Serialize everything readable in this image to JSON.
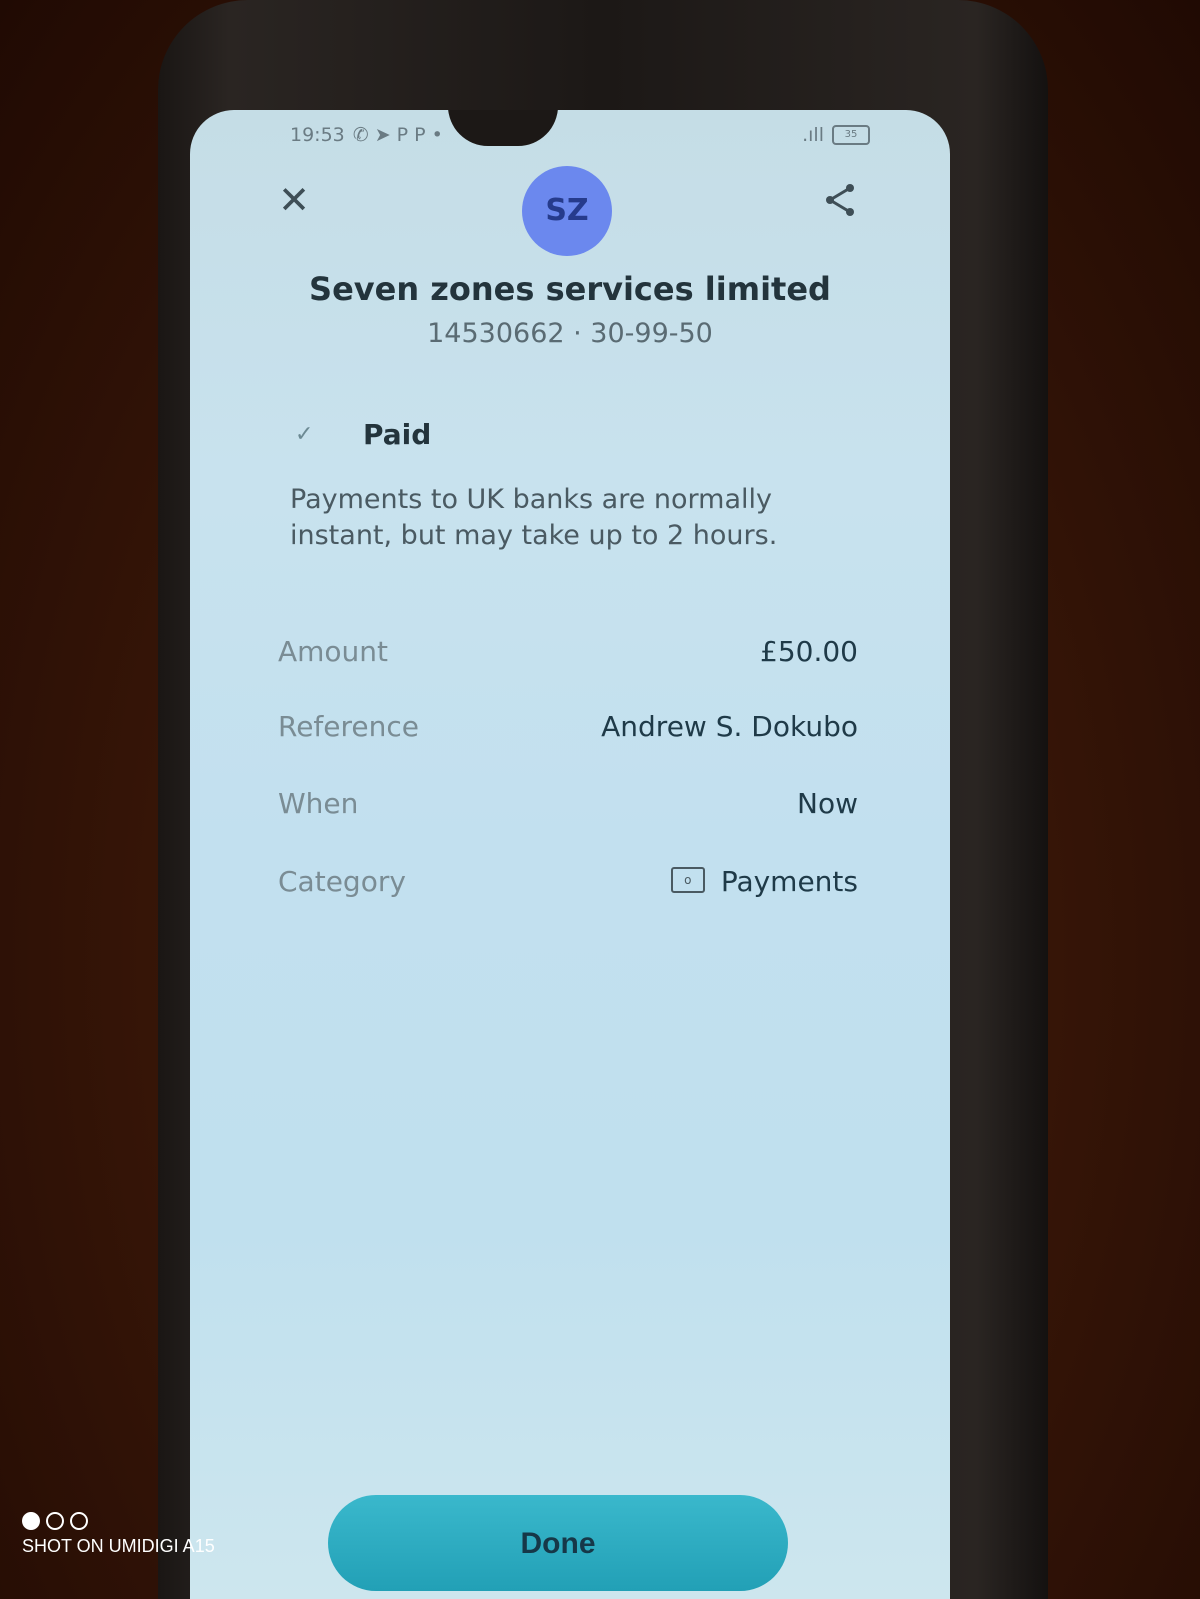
{
  "status_bar": {
    "time": "19:53",
    "indicators": "✆ ➤ P P •",
    "signal": ".ıll",
    "battery": "35"
  },
  "header": {
    "avatar_initials": "SZ",
    "close_icon": "close-icon",
    "share_icon": "share-icon",
    "avatar_color": "#6b88ee"
  },
  "payee": {
    "name": "Seven zones services limited",
    "account": "14530662 · 30-99-50"
  },
  "payment_status": {
    "label": "Paid",
    "icon": "check-icon",
    "info": "Payments to UK banks are normally instant, but may take up to 2 hours."
  },
  "details": {
    "amount_label": "Amount",
    "amount_value": "£50.00",
    "reference_label": "Reference",
    "reference_value": "Andrew S. Dokubo",
    "when_label": "When",
    "when_value": "Now",
    "category_label": "Category",
    "category_value": "Payments",
    "category_icon": "banknote-icon"
  },
  "actions": {
    "done_label": "Done",
    "done_color": "#22a0b6"
  },
  "watermark": {
    "text": "SHOT ON UMIDIGI A15"
  }
}
